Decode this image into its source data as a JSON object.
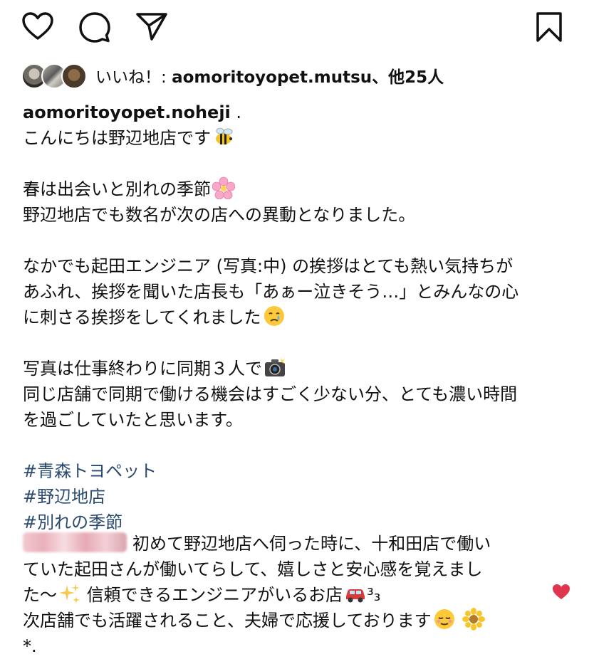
{
  "actions": {
    "like_icon": "heart-outline-icon",
    "comment_icon": "comment-bubble-icon",
    "share_icon": "paper-plane-icon",
    "save_icon": "bookmark-icon"
  },
  "likes": {
    "prefix": "いいね！: ",
    "user": "aomoritoyopet.mutsu",
    "suffix": "、他25人"
  },
  "caption": {
    "username": "aomoritoyopet.noheji",
    "dot": " .",
    "lines": [
      "こんにちは野辺地店です",
      "春は出会いと別れの季節",
      "野辺地店でも数名が次の店への異動となりました。",
      "なかでも起田エンジニア (写真:中) の挨拶はとても熱い気持ちが",
      "あふれ、挨拶を聞いた店長も「あぁー泣きそう…」とみんなの心",
      "に刺さる挨拶をしてくれました",
      "写真は仕事終わりに同期３人で",
      "同じ店舗で同期で働ける機会はすごく少ない分、とても濃い時間",
      "を過ごしていたと思います。"
    ],
    "hashtags": [
      "#青森トヨペット",
      "#野辺地店",
      "#別れの季節"
    ]
  },
  "comment": {
    "lines": [
      "初めて野辺地店へ伺った時に、十和田店で働い",
      "ていた起田さんが働いてらして、嬉しさと安心感を覚えまし",
      "た〜",
      "信頼できるエンジニアがいるお店",
      "³₃",
      "次店舗でも活躍されること、夫婦で応援しております",
      "*."
    ]
  },
  "colors": {
    "hashtag": "#2b4a6f",
    "like_red": "#e0344f"
  }
}
